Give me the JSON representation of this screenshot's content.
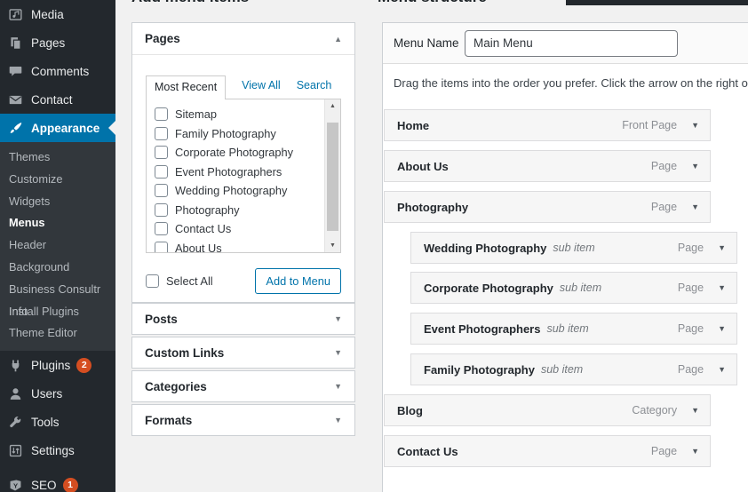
{
  "colors": {
    "accent": "#0073aa",
    "sidebar_bg": "#23282d",
    "sidebar_submenu_bg": "#32373c",
    "selected_item_bg": "#0073aa",
    "badge": "#d54e21",
    "menu_item_bg": "#f6f6f6"
  },
  "icons": {
    "collapse": "▲",
    "expand": "▼"
  },
  "sidebar": {
    "items": [
      {
        "label": "Media"
      },
      {
        "label": "Pages"
      },
      {
        "label": "Comments"
      },
      {
        "label": "Contact"
      },
      {
        "label": "Appearance",
        "selected": true
      },
      {
        "label": "Plugins",
        "badge": "2"
      },
      {
        "label": "Users"
      },
      {
        "label": "Tools"
      },
      {
        "label": "Settings"
      },
      {
        "label": "SEO",
        "badge": "1"
      }
    ],
    "appearance_submenu": [
      "Themes",
      "Customize",
      "Widgets",
      "Menus",
      "Header",
      "Background",
      "Business Consultr Info",
      "Install Plugins",
      "Theme Editor"
    ],
    "current_submenu_item": "Menus"
  },
  "add_menu_items": {
    "heading": "Add menu items",
    "pages_panel": {
      "title": "Pages",
      "tabs": [
        {
          "label": "Most Recent",
          "active": true
        },
        {
          "label": "View All",
          "active": false
        },
        {
          "label": "Search",
          "active": false
        }
      ],
      "page_checkboxes": [
        "Sitemap",
        "Family Photography",
        "Corporate Photography",
        "Event Photographers",
        "Wedding Photography",
        "Photography",
        "Contact Us",
        "About Us"
      ],
      "select_all_label": "Select All",
      "add_to_menu_label": "Add to Menu"
    },
    "accordions": [
      {
        "title": "Posts"
      },
      {
        "title": "Custom Links"
      },
      {
        "title": "Categories"
      },
      {
        "title": "Formats"
      }
    ]
  },
  "menu_structure": {
    "heading": "Menu structure",
    "menu_name_label": "Menu Name",
    "menu_name_value": "Main Menu",
    "drag_text": "Drag the items into the order you prefer. Click the arrow on the right of the item to reveal additional configuration options.",
    "sub_item_label": "sub item",
    "items": [
      {
        "title": "Home",
        "type": "Front Page",
        "sub": false
      },
      {
        "title": "About Us",
        "type": "Page",
        "sub": false
      },
      {
        "title": "Photography",
        "type": "Page",
        "sub": false
      },
      {
        "title": "Wedding Photography",
        "type": "Page",
        "sub": true
      },
      {
        "title": "Corporate Photography",
        "type": "Page",
        "sub": true
      },
      {
        "title": "Event Photographers",
        "type": "Page",
        "sub": true
      },
      {
        "title": "Family Photography",
        "type": "Page",
        "sub": true
      },
      {
        "title": "Blog",
        "type": "Category",
        "sub": false
      },
      {
        "title": "Contact Us",
        "type": "Page",
        "sub": false
      }
    ]
  }
}
